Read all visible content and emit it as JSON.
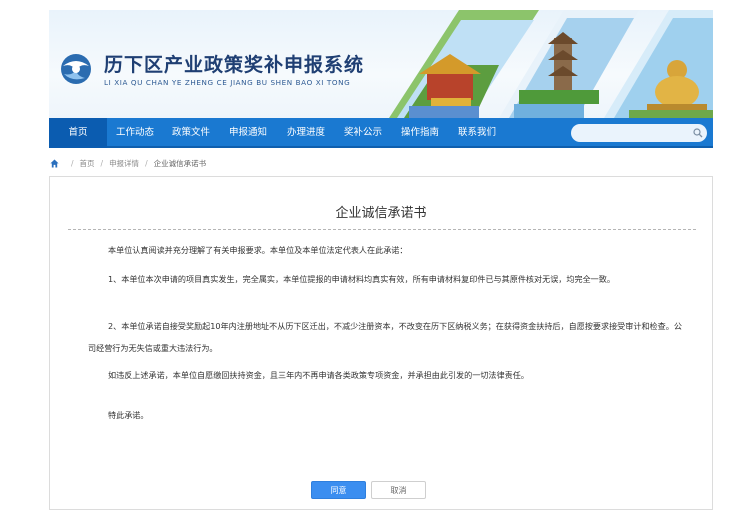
{
  "header": {
    "title": "历下区产业政策奖补申报系统",
    "subtitle": "LI XIA QU CHAN YE ZHENG CE JIANG BU SHEN BAO XI TONG",
    "logo_icon": "globe-logo-icon"
  },
  "nav": {
    "items": [
      {
        "label": "首页",
        "active": true
      },
      {
        "label": "工作动态",
        "active": false
      },
      {
        "label": "政策文件",
        "active": false
      },
      {
        "label": "申报通知",
        "active": false
      },
      {
        "label": "办理进度",
        "active": false
      },
      {
        "label": "奖补公示",
        "active": false
      },
      {
        "label": "操作指南",
        "active": false
      },
      {
        "label": "联系我们",
        "active": false
      }
    ],
    "search_placeholder": "",
    "search_icon": "search-icon"
  },
  "breadcrumb": {
    "home_icon": "home-icon",
    "items": [
      "首页",
      "申报详情",
      "企业诚信承诺书"
    ]
  },
  "document": {
    "title": "企业诚信承诺书",
    "paragraphs": [
      "本单位认真阅读并充分理解了有关申报要求。本单位及本单位法定代表人在此承诺：",
      "1、本单位本次申请的项目真实发生，完全属实，本单位提报的申请材料均真实有效，所有申请材料复印件已与其原件核对无误，均完全一致。",
      "2、本单位承诺自接受奖励起10年内注册地址不从历下区迁出，不减少注册资本，不改变在历下区纳税义务；在获得资金扶持后，自愿按要求接受审计和检查。公司经营行为无失信或重大违法行为。",
      "如违反上述承诺，本单位自愿缴回扶持资金，且三年内不再申请各类政策专项资金，并承担由此引发的一切法律责任。",
      "特此承诺。"
    ]
  },
  "buttons": {
    "agree": "同意",
    "cancel": "取消"
  },
  "colors": {
    "nav_bg": "#1a79d1",
    "nav_active": "#0b5cb0",
    "primary_button": "#3b8ef0",
    "title_text": "#1f3f73"
  }
}
